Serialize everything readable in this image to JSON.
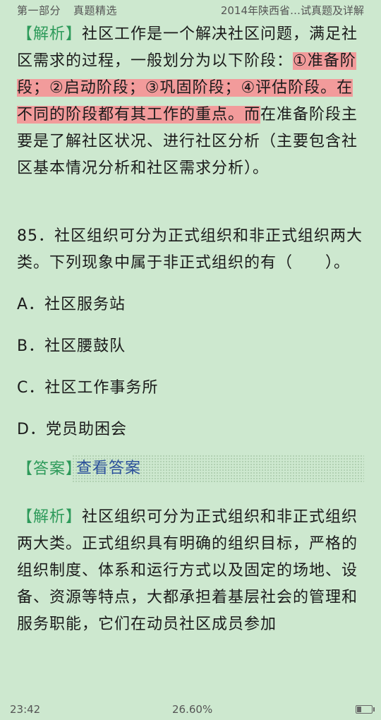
{
  "header": {
    "section": "第一部分",
    "subtitle": "真题精选",
    "book_title": "2014年陕西省…试真题及详解"
  },
  "analysis1": {
    "tag": "【解析】",
    "text_a": "社区工作是一个解决社区问题，满足社区需求的过程，一般划分为以下阶段：",
    "highlight": "①准备阶段；②启动阶段；③巩固阶段；④评估阶段。在不同的阶段都有其工作的重点。而",
    "text_b": "在准备阶段主要是了解社区状况、进行社区分析（主要包含社区基本情况分析和社区需求分析）。"
  },
  "question": {
    "stem": "85．社区组织可分为正式组织和非正式组织两大类。下列现象中属于非正式组织的有（　　）。",
    "options": [
      "A．社区服务站",
      "B．社区腰鼓队",
      "C．社区工作事务所",
      "D．党员助困会"
    ]
  },
  "answer": {
    "tag": "【答案】",
    "button_label": "查看答案"
  },
  "analysis2": {
    "tag": "【解析】",
    "text": "社区组织可分为正式组织和非正式组织两大类。正式组织具有明确的组织目标，严格的组织制度、体系和运行方式以及固定的场地、设备、资源等特点，大都承担着基层社会的管理和服务职能，它们在动员社区成员参加"
  },
  "footer": {
    "time": "23:42",
    "progress": "26.60%",
    "battery_level": 0.3
  }
}
